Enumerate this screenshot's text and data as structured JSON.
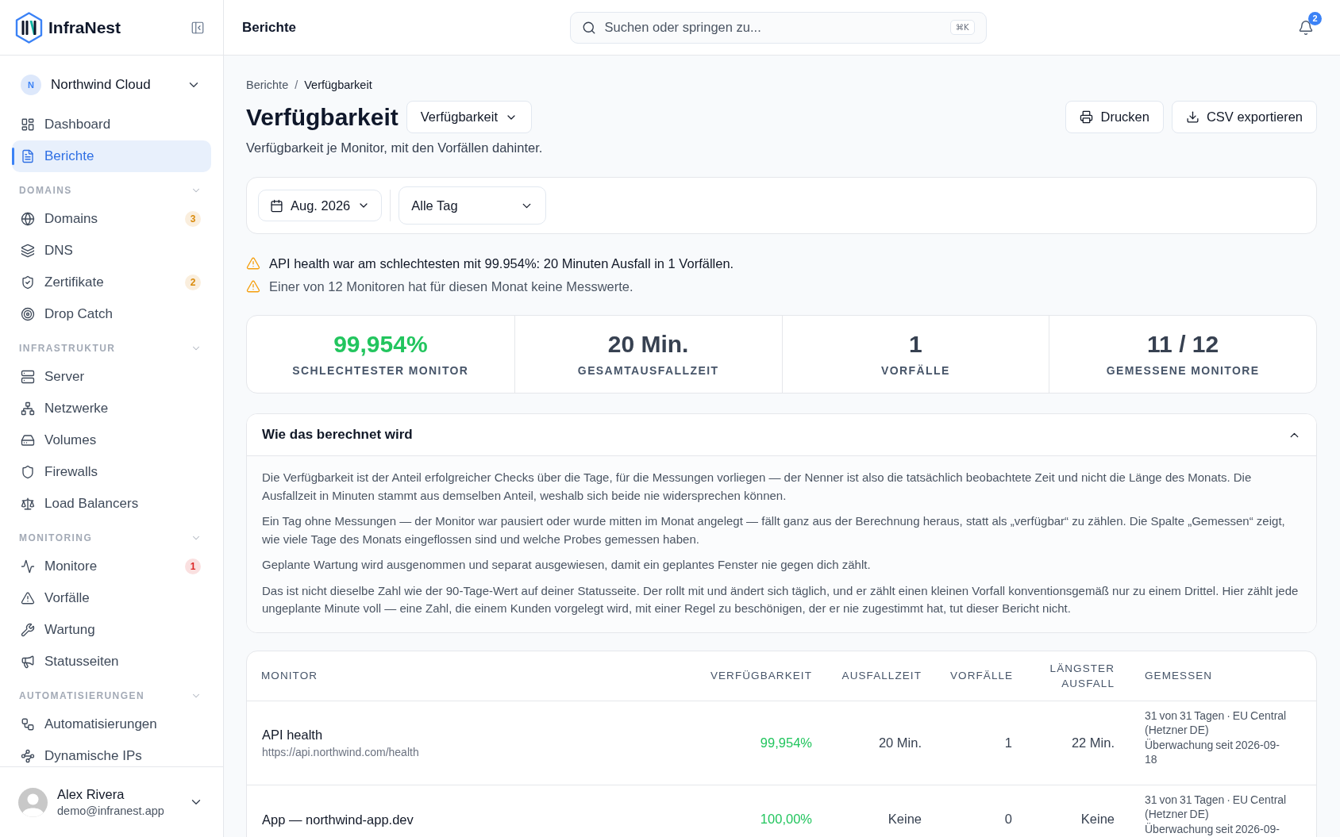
{
  "sidebar": {
    "brand": "InfraNest",
    "org": {
      "initial": "N",
      "name": "Northwind Cloud"
    },
    "items": [
      {
        "label": "Dashboard",
        "selected": false
      },
      {
        "label": "Berichte",
        "selected": true
      }
    ],
    "sections": [
      {
        "title": "DOMAINS",
        "expanded": true,
        "items": [
          {
            "label": "Domains",
            "selected": false,
            "badge": {
              "text": "3",
              "color": "#d98a0b"
            }
          },
          {
            "label": "DNS",
            "selected": false
          },
          {
            "label": "Zertifikate",
            "selected": false,
            "badge": {
              "text": "2",
              "color": "#d98a0b"
            }
          },
          {
            "label": "Drop Catch",
            "selected": false
          }
        ]
      },
      {
        "title": "INFRASTRUKTUR",
        "expanded": true,
        "items": [
          {
            "label": "Server",
            "selected": false
          },
          {
            "label": "Netzwerke",
            "selected": false
          },
          {
            "label": "Volumes",
            "selected": false
          },
          {
            "label": "Firewalls",
            "selected": false
          },
          {
            "label": "Load Balancers",
            "selected": false
          }
        ]
      },
      {
        "title": "MONITORING",
        "expanded": true,
        "items": [
          {
            "label": "Monitore",
            "selected": false,
            "badge": {
              "text": "1",
              "color": "#dc2626"
            }
          },
          {
            "label": "Vorfälle",
            "selected": false
          },
          {
            "label": "Wartung",
            "selected": false
          },
          {
            "label": "Statusseiten",
            "selected": false
          }
        ]
      },
      {
        "title": "AUTOMATISIERUNGEN",
        "expanded": true,
        "items": [
          {
            "label": "Automatisierungen",
            "selected": false
          },
          {
            "label": "Dynamische IPs",
            "selected": false
          }
        ]
      }
    ],
    "user": {
      "name": "Alex Rivera",
      "email": "demo@infranest.app"
    }
  },
  "top_bar": {
    "title": "Berichte",
    "search": {
      "placeholder": "Suchen oder springen zu...",
      "shortcut": "⌘K"
    },
    "notifications": {
      "count": "2"
    }
  },
  "page": {
    "breadcrumb": {
      "items": [
        "Berichte",
        "Verfügbarkeit"
      ],
      "separator": "/"
    },
    "title": "Verfügbarkeit",
    "report_select": "Verfügbarkeit",
    "actions": [
      {
        "label": "Drucken"
      },
      {
        "label": "CSV exportieren"
      }
    ],
    "subtitle": "Verfügbarkeit je Monitor, mit den Vorfällen dahinter."
  },
  "filters": {
    "month": "Aug. 2026",
    "day": "Alle Tag"
  },
  "alerts": [
    {
      "kind": "headline",
      "text": "API health war am schlechtesten mit 99.954%: 20 Minuten Ausfall in 1 Vorfällen."
    },
    {
      "kind": "note",
      "text": "Einer von 12 Monitoren hat für diesen Monat keine Messwerte."
    }
  ],
  "stats": [
    {
      "value": "99,954%",
      "label": "SCHLECHTESTER MONITOR",
      "color": "#22c55e"
    },
    {
      "value": "20 Min.",
      "label": "GESAMTAUSFALLZEIT",
      "color": "#374151"
    },
    {
      "value": "1",
      "label": "VORFÄLLE",
      "color": "#374151"
    },
    {
      "value": "11 / 12",
      "label": "GEMESSENE MONITORE",
      "color": "#374151"
    }
  ],
  "explanation": {
    "title": "Wie das berechnet wird",
    "expanded": true,
    "paragraphs": [
      "Die Verfügbarkeit ist der Anteil erfolgreicher Checks über die Tage, für die Messungen vorliegen — der Nenner ist also die tatsächlich beobachtete Zeit und nicht die Länge des Monats. Die Ausfallzeit in Minuten stammt aus demselben Anteil, weshalb sich beide nie widersprechen können.",
      "Ein Tag ohne Messungen — der Monitor war pausiert oder wurde mitten im Monat angelegt — fällt ganz aus der Berechnung heraus, statt als „verfügbar“ zu zählen. Die Spalte „Gemessen“ zeigt, wie viele Tage des Monats eingeflossen sind und welche Probes gemessen haben.",
      "Geplante Wartung wird ausgenommen und separat ausgewiesen, damit ein geplantes Fenster nie gegen dich zählt.",
      "Das ist nicht dieselbe Zahl wie der 90-Tage-Wert auf deiner Statusseite. Der rollt mit und ändert sich täglich, und er zählt einen kleinen Vorfall konventionsgemäß nur zu einem Drittel. Hier zählt jede ungeplante Minute voll — eine Zahl, die einem Kunden vorgelegt wird, mit einer Regel zu beschönigen, der er nie zugestimmt hat, tut dieser Bericht nicht."
    ]
  },
  "table": {
    "columns": [
      "MONITOR",
      "VERFÜGBARKEIT",
      "AUSFALLZEIT",
      "VORFÄLLE",
      "LÄNGSTER AUSFALL",
      "GEMESSEN"
    ],
    "rows": [
      {
        "name": "API health",
        "url": "https://api.northwind.com/health",
        "availability": {
          "text": "99,954%",
          "color": "#22c55e"
        },
        "downtime": "20 Min.",
        "incidents": "1",
        "longest": "22 Min.",
        "measured": [
          "31 von 31 Tagen · EU Central (Hetzner DE)",
          "Überwachung seit 2026-09-18"
        ]
      },
      {
        "name": "App — northwind-app.dev",
        "availability": {
          "text": "100,00%",
          "color": "#22c55e"
        },
        "downtime": "Keine",
        "incidents": "0",
        "longest": "Keine",
        "measured": [
          "31 von 31 Tagen · EU Central (Hetzner DE)",
          "Überwachung seit 2026-09-"
        ]
      }
    ]
  }
}
